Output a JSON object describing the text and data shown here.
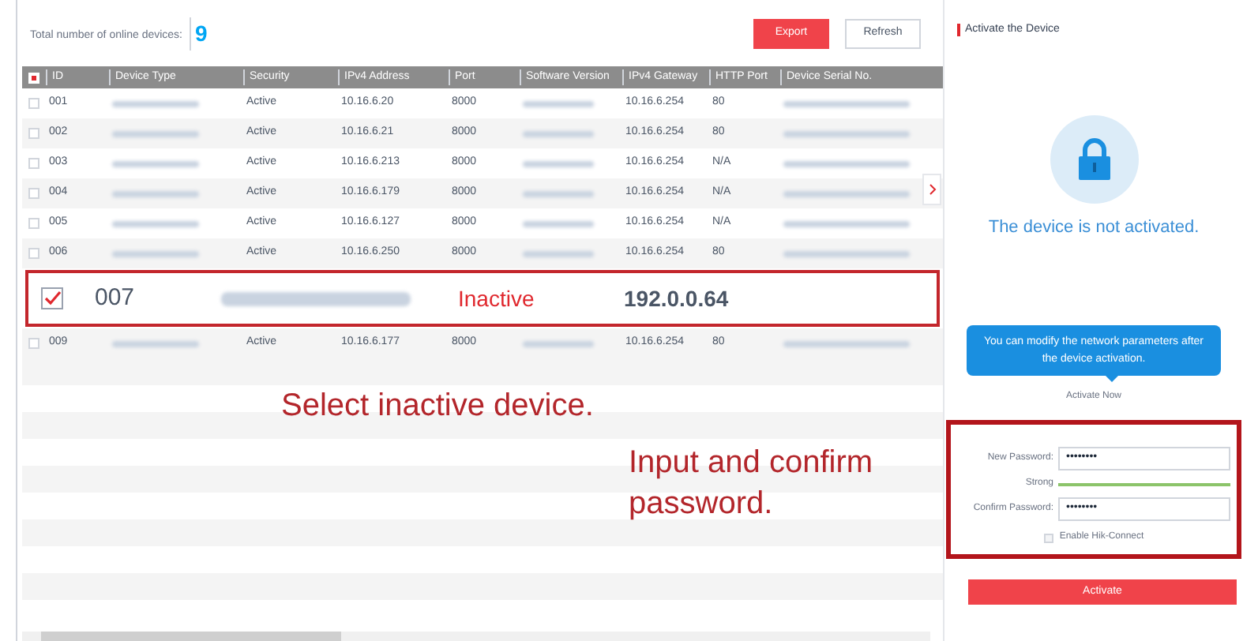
{
  "devices_panel": {
    "total_label": "Total number of online devices:",
    "total_count": "9",
    "buttons": [
      {
        "label": "Export",
        "kind": "primary"
      },
      {
        "label": "Refresh",
        "kind": "secondary"
      }
    ],
    "columns": [
      "ID",
      "Device Type",
      "Security",
      "IPv4 Address",
      "Port",
      "Software Version",
      "IPv4 Gateway",
      "HTTP Port",
      "Device Serial No."
    ],
    "header_checkbox": {
      "checked": true
    },
    "rows": [
      {
        "id": "001",
        "security": "Active",
        "warning": false,
        "ipv4": "10.16.6.20",
        "port": "8000",
        "gateway": "10.16.6.254",
        "http_port": "80",
        "selected": false
      },
      {
        "id": "002",
        "security": "Active",
        "warning": false,
        "ipv4": "10.16.6.21",
        "port": "8000",
        "gateway": "10.16.6.254",
        "http_port": "80",
        "selected": false
      },
      {
        "id": "003",
        "security": "Active",
        "warning": false,
        "ipv4": "10.16.6.213",
        "port": "8000",
        "gateway": "10.16.6.254",
        "http_port": "N/A",
        "selected": false
      },
      {
        "id": "004",
        "security": "Active",
        "warning": false,
        "ipv4": "10.16.6.179",
        "port": "8000",
        "gateway": "10.16.6.254",
        "http_port": "N/A",
        "selected": false
      },
      {
        "id": "005",
        "security": "Active",
        "warning": false,
        "ipv4": "10.16.6.127",
        "port": "8000",
        "gateway": "10.16.6.254",
        "http_port": "N/A",
        "selected": false
      },
      {
        "id": "006",
        "security": "Active",
        "warning": false,
        "ipv4": "10.16.6.250",
        "port": "8000",
        "gateway": "10.16.6.254",
        "http_port": "80",
        "selected": false
      }
    ],
    "selected_device_callout": {
      "id": "007",
      "security": "Inactive",
      "ip_address": "192.0.0.64",
      "checked": true
    },
    "rows_after": [
      {
        "id": "009",
        "security": "Active",
        "warning": false,
        "ipv4": "10.16.6.177",
        "port": "8000",
        "gateway": "10.16.6.254",
        "http_port": "80",
        "selected": false
      }
    ],
    "annotation": "Select inactive device."
  },
  "activate_panel": {
    "title": "Activate the Device",
    "status": "The device is not activated.",
    "tooltip": "You can modify the network parameters after the device activation.",
    "activate_now": "Activate Now",
    "new_password": {
      "label": "New Password:",
      "value": "••••••••"
    },
    "strength": {
      "label": "Strong",
      "level": 1
    },
    "confirm_password": {
      "label": "Confirm Password:",
      "value": "••••••••"
    },
    "hik_connect": {
      "label": "Enable Hik-Connect",
      "checked": false
    },
    "activate_button": "Activate",
    "annotation": "Input and confirm password."
  }
}
